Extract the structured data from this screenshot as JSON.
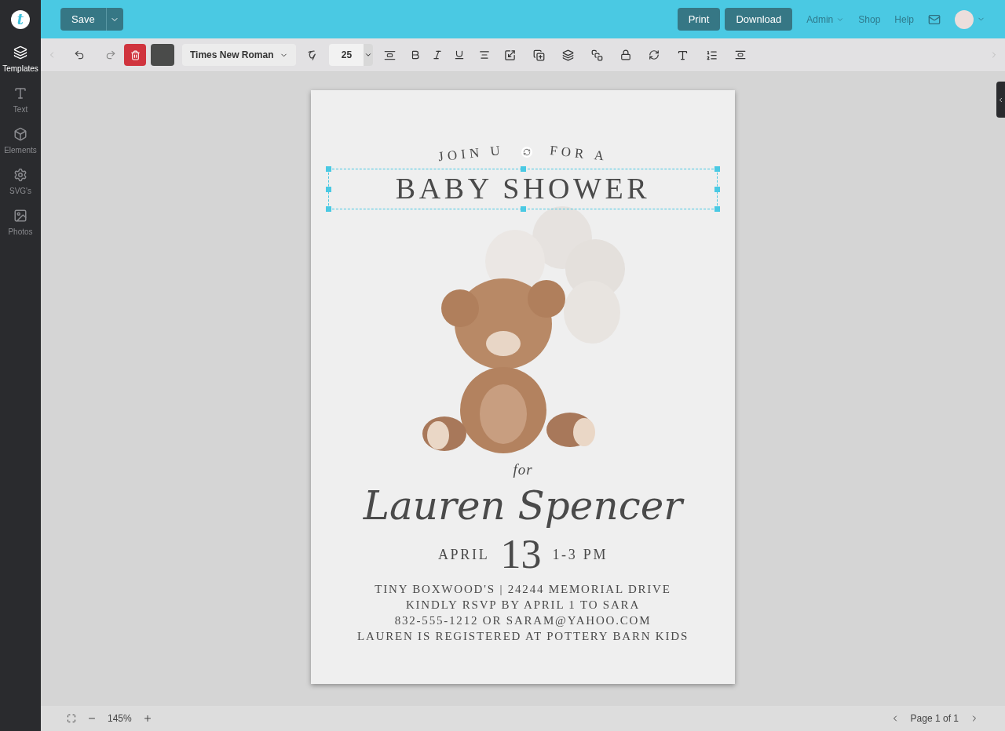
{
  "logo": "t",
  "header": {
    "save": "Save",
    "print": "Print",
    "download": "Download",
    "links": [
      {
        "label": "Admin",
        "dropdown": true
      },
      {
        "label": "Shop",
        "dropdown": false
      },
      {
        "label": "Help",
        "dropdown": false
      }
    ]
  },
  "sidebar": {
    "items": [
      {
        "label": "Templates",
        "selected": true
      },
      {
        "label": "Text",
        "selected": false
      },
      {
        "label": "Elements",
        "selected": false
      },
      {
        "label": "SVG's",
        "selected": false
      },
      {
        "label": "Photos",
        "selected": false
      }
    ]
  },
  "toolbar": {
    "font": "Times New Roman",
    "size": "25"
  },
  "card": {
    "arc_left": "JOIN U",
    "arc_right": "FOR A",
    "title": "BABY SHOWER",
    "title_selected": true,
    "for": "for",
    "name": "Lauren Spencer",
    "month": "APRIL",
    "day": "13",
    "time": "1-3 PM",
    "lines": [
      "TINY BOXWOOD'S | 24244 MEMORIAL DRIVE",
      "KINDLY RSVP BY APRIL 1 TO SARA",
      "832-555-1212 OR SARAM@YAHOO.COM",
      "LAUREN IS REGISTERED AT POTTERY BARN KIDS"
    ]
  },
  "footer": {
    "zoom": "145%",
    "page": "Page 1 of 1"
  }
}
